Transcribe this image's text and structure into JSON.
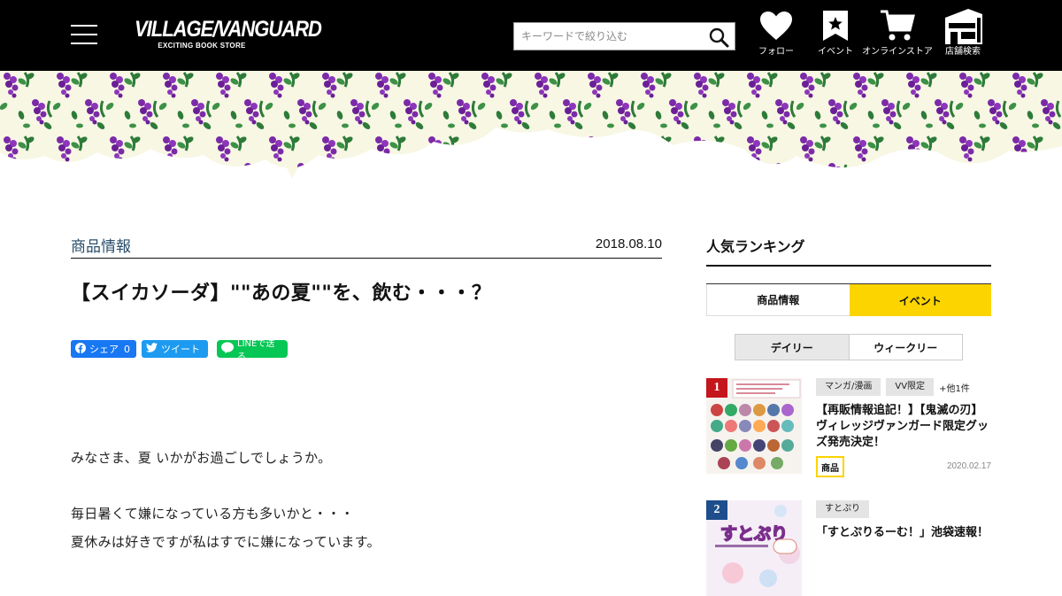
{
  "header": {
    "logo_main": "VILLAGE/VANGUARD",
    "logo_sub": "EXCITING BOOK STORE",
    "search_placeholder": "キーワードで絞り込む",
    "nav": [
      {
        "label": "フォロー",
        "icon": "heart-icon"
      },
      {
        "label": "イベント",
        "icon": "star-bookmark-icon"
      },
      {
        "label": "オンラインストア",
        "icon": "cart-icon"
      },
      {
        "label": "店舗検索",
        "icon": "store-icon"
      }
    ]
  },
  "banner": {
    "theme": "purple grape and green leaf pattern",
    "colors": [
      "#7a2aa6",
      "#2f7d3a",
      "#f7f7e6"
    ]
  },
  "article": {
    "category": "商品情報",
    "date": "2018.08.10",
    "title": "【スイカソーダ】\"\"あの夏\"\"を、飲む・・・？",
    "share": {
      "facebook": "シェア",
      "facebook_count": "0",
      "twitter": "ツイート",
      "line": "LINEで送る"
    },
    "paragraphs": [
      "みなさま、夏 いかがお過ごしでしょうか。",
      "毎日暑くて嫌になっている方も多いかと・・・",
      "夏休みは好きですが私はすでに嫌になっています。"
    ]
  },
  "sidebar": {
    "title": "人気ランキング",
    "tabs": [
      "商品情報",
      "イベント"
    ],
    "subtabs": [
      "デイリー",
      "ウィークリー"
    ],
    "ranks": [
      {
        "num": "1",
        "tags": [
          "マンガ/漫画",
          "VV限定"
        ],
        "more": "+他1件",
        "title": "【再販情報追記！】【鬼滅の刃】ヴィレッジヴァンガード限定グッズ発売決定！",
        "badge": "商品",
        "date": "2020.02.17"
      },
      {
        "num": "2",
        "tags": [
          "すとぷり"
        ],
        "more": "",
        "title": "「すとぷりるーむ！」池袋速報！",
        "badge": "",
        "date": ""
      }
    ]
  },
  "colors": {
    "accent_yellow": "#fcd400",
    "category_blue": "#2a4e6c",
    "rank1": "#c4161c",
    "rank2": "#1f4e8c"
  }
}
